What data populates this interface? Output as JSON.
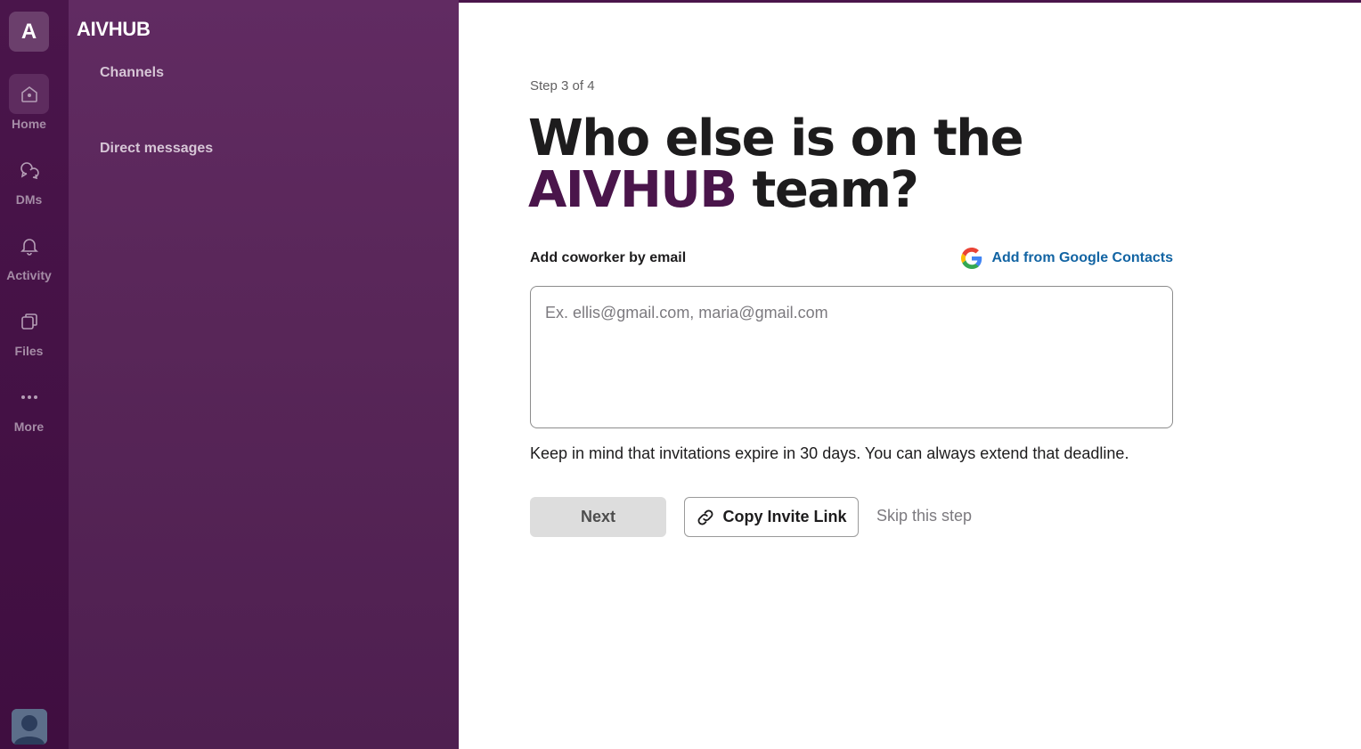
{
  "workspace": {
    "initial": "A",
    "name": "AIVHUB"
  },
  "rail": {
    "items": [
      {
        "label": "Home",
        "icon": "home-icon"
      },
      {
        "label": "DMs",
        "icon": "dms-icon"
      },
      {
        "label": "Activity",
        "icon": "bell-icon"
      },
      {
        "label": "Files",
        "icon": "files-icon"
      },
      {
        "label": "More",
        "icon": "more-icon"
      }
    ]
  },
  "sidebar": {
    "sections": [
      {
        "label": "Channels"
      },
      {
        "label": "Direct messages"
      }
    ]
  },
  "main": {
    "step": "Step 3 of 4",
    "headline_part1": "Who else is on the",
    "headline_brand": "AIVHUB",
    "headline_part2": " team?",
    "field_label": "Add coworker by email",
    "google_link": "Add from Google Contacts",
    "email_placeholder": "Ex. ellis@gmail.com, maria@gmail.com",
    "email_value": "",
    "note": "Keep in mind that invitations expire in 30 days. You can always extend that deadline.",
    "next_label": "Next",
    "copy_label": "Copy Invite Link",
    "skip_label": "Skip this step"
  },
  "colors": {
    "rail": "#3f0e40",
    "sidebar": "#582658",
    "brand": "#4a154b",
    "link": "#1264a3"
  }
}
